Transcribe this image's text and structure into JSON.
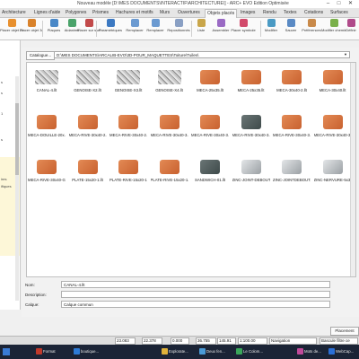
{
  "window": {
    "title": "Nouveau modèle [D:\\MES DOCUMENTS\\INTERACTIF\\ARCHITECTURE\\] - ARC+ EVO Edition Optimisée",
    "minimize": "–",
    "maximize": "□",
    "close": "✕"
  },
  "ribbon_tabs": [
    {
      "label": "Architecture"
    },
    {
      "label": "Lignes d'aide"
    },
    {
      "label": "Polygones"
    },
    {
      "label": "Prismes"
    },
    {
      "label": "Hachures et motifs"
    },
    {
      "label": "Murs"
    },
    {
      "label": "Ouvertures"
    },
    {
      "label": "Objets placés"
    },
    {
      "label": "Images"
    },
    {
      "label": "Rendu"
    },
    {
      "label": "Textes"
    },
    {
      "label": "Cotations"
    },
    {
      "label": "Surfaces"
    },
    {
      "label": "Dossier"
    }
  ],
  "ribbon_buttons": [
    {
      "label": "Placer objet 2d",
      "color": "#e8902e"
    },
    {
      "label": "Placer objet 3d",
      "color": "#d9822b"
    },
    {
      "label": "Plaques",
      "color": "#4a88c7"
    },
    {
      "label": "Aidanims",
      "color": "#4aa36a"
    },
    {
      "label": "Placer sur surface",
      "color": "#c24a4a"
    },
    {
      "label": "Paramétriques",
      "color": "#3c79c2"
    },
    {
      "label": "Remplacer",
      "color": "#6b9ad1"
    },
    {
      "label": "Remplacer",
      "color": "#6b9ad1"
    },
    {
      "label": "Repositionnés",
      "color": "#8aa0c4"
    },
    {
      "label": "Liste",
      "color": "#c9a64a"
    },
    {
      "label": "Assembler",
      "color": "#9a6ac4"
    },
    {
      "label": "Placer symbole",
      "color": "#d24a6b"
    },
    {
      "label": "Modifier",
      "color": "#4a9ac4"
    },
    {
      "label": "Sauver",
      "color": "#5a8ac4"
    },
    {
      "label": "Préférences",
      "color": "#c98a4a"
    },
    {
      "label": "Modifier chemin",
      "color": "#7ab04a"
    },
    {
      "label": "Définir",
      "color": "#b04a8a"
    }
  ],
  "left_panel": {
    "lines": [
      "s",
      "s",
      "1",
      "",
      "s",
      "ires",
      "ifiques"
    ]
  },
  "dialog": {
    "catalogue_button": "Catalogue...",
    "path": "D:\\MES DOCUMENTS\\ARCALIB-EVO\\3D-POUR_MAQUETTES\\Toiture\\Tuiles\\",
    "dropdown_arrow": "▼",
    "items": [
      {
        "label": "CANAL-4.llt",
        "kind": "roof"
      },
      {
        "label": "GENOISE-X2.llt",
        "kind": "roof"
      },
      {
        "label": "GENOISE-X3.llt",
        "kind": "roof"
      },
      {
        "label": "GENOISE-X4.llt",
        "kind": "roof"
      },
      {
        "label": "MECA-25x35.llt",
        "kind": "tile"
      },
      {
        "label": "MECA-25x35.llt",
        "kind": "tile"
      },
      {
        "label": "MECA-30x40-2.llt",
        "kind": "tile"
      },
      {
        "label": "MECA-30x40.llt",
        "kind": "tile"
      },
      {
        "label": "MECA-DOUILLE-20x...",
        "kind": "tile"
      },
      {
        "label": "MECA-RIVE-30x40-2...",
        "kind": "tile"
      },
      {
        "label": "MECA-RIVE-30x40-2...",
        "kind": "tile"
      },
      {
        "label": "MECA-RIVE-30x40-3...",
        "kind": "tile"
      },
      {
        "label": "MECA-RIVE-30x40-3...",
        "kind": "tile"
      },
      {
        "label": "MECA-RIVE-30x40-3...",
        "kind": "dark"
      },
      {
        "label": "MECA-RIVE-30x40-3...",
        "kind": "tile"
      },
      {
        "label": "MECA-RIVE-30x40-3...",
        "kind": "tile"
      },
      {
        "label": "MECA-RIVE-30x40-G.llt",
        "kind": "tile"
      },
      {
        "label": "PLATE-15x20-1.llt",
        "kind": "tile"
      },
      {
        "label": "PLATE-RIVE-15x20-1...",
        "kind": "tile"
      },
      {
        "label": "PLATE-RIVE-15x20-1...",
        "kind": "tile"
      },
      {
        "label": "SANDWICH-01.llt",
        "kind": "dark"
      },
      {
        "label": "ZINC-JOINT-DEBOUT...",
        "kind": "zinc"
      },
      {
        "label": "ZINC-JOINTDEBOUT...",
        "kind": "zinc"
      },
      {
        "label": "ZINC-NERVURE-5x3.llt",
        "kind": "zinc"
      }
    ],
    "name_label": "Nom:",
    "name_value": "CANAL-4.llt",
    "description_label": "Description:",
    "description_value": "",
    "layer_label": "Calque:",
    "layer_value": "Calque commun",
    "placer_button": "Placement"
  },
  "colors": {
    "tile": "#c8612f",
    "tile_light": "#e38a55",
    "dark": "#3e4a4a",
    "zinc": "#9aa0a4"
  },
  "status_bar": {
    "x_value": "23.083",
    "y_value": "22.378",
    "z_value": "0.000",
    "length": "36.755",
    "angle": "145.91",
    "scale": "1:100.00",
    "mode": "Navigation",
    "bascule": "Bascule filtre ce"
  },
  "taskbar": {
    "items": [
      {
        "label": "Format",
        "color": "#c0392b"
      },
      {
        "label": "boutique...",
        "color": "#2e7bd6"
      },
      {
        "label": "Explorate...",
        "color": "#e0b23a"
      },
      {
        "label": "Deux fen...",
        "color": "#4a9ad6"
      },
      {
        "label": "Le Colom...",
        "color": "#3aa65a"
      },
      {
        "label": "Mots de...",
        "color": "#c04a9a"
      },
      {
        "label": "WebCap...",
        "color": "#2b6fd6"
      }
    ]
  }
}
